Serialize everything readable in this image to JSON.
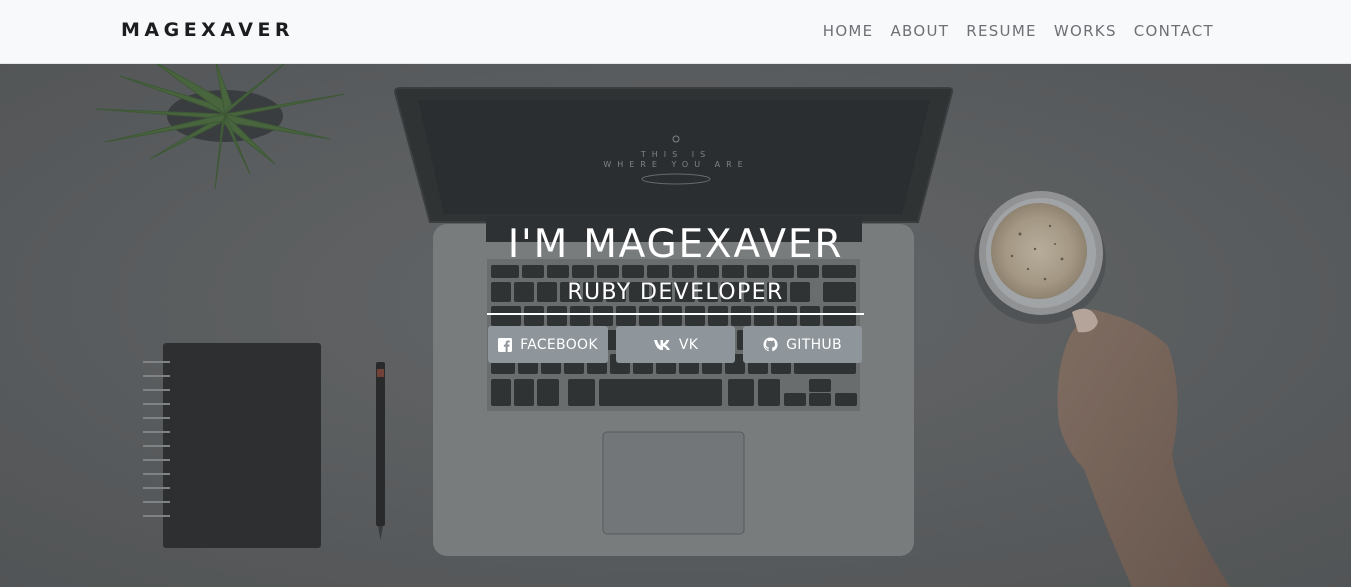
{
  "nav": {
    "brand": "MAGEXAVER",
    "links": [
      "HOME",
      "ABOUT",
      "RESUME",
      "WORKS",
      "CONTACT"
    ]
  },
  "hero": {
    "title": "I'M MAGEXAVER",
    "subtitle": "RUBY DEVELOPER",
    "screen_text_line1": "THIS IS",
    "screen_text_line2": "WHERE YOU ARE",
    "social": [
      {
        "label": "FACEBOOK",
        "icon": "facebook-icon"
      },
      {
        "label": "VK",
        "icon": "vk-icon"
      },
      {
        "label": "GITHUB",
        "icon": "github-icon"
      }
    ]
  },
  "colors": {
    "navbar_bg": "#f8f9fa",
    "brand": "#1c1d1f",
    "nav_link": "#6d7176",
    "hero_overlay": "#606264",
    "button_bg": "#8e959b",
    "text_light": "#ffffff"
  }
}
